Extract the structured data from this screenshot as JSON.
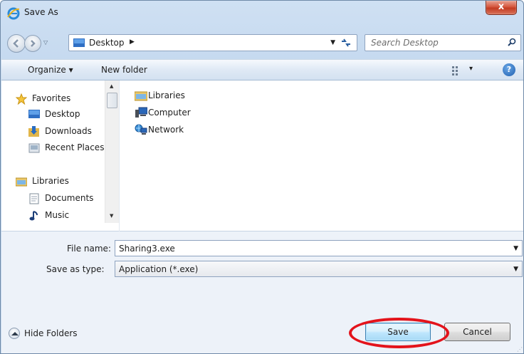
{
  "window": {
    "title": "Save As",
    "close_glyph": "x"
  },
  "address": {
    "location": "Desktop",
    "crumb_arrow": "▶",
    "search_placeholder": "Search Desktop"
  },
  "toolbar": {
    "organize_label": "Organize ▾",
    "new_folder_label": "New folder",
    "views_label": "▾",
    "help_label": "?"
  },
  "nav_pane": {
    "items": [
      {
        "label": "Favorites",
        "icon": "star-icon"
      },
      {
        "label": "Desktop",
        "icon": "desktop-icon"
      },
      {
        "label": "Downloads",
        "icon": "downloads-icon"
      },
      {
        "label": "Recent Places",
        "icon": "recent-places-icon"
      },
      {
        "label": "Libraries",
        "icon": "libraries-icon"
      },
      {
        "label": "Documents",
        "icon": "documents-icon"
      },
      {
        "label": "Music",
        "icon": "music-icon"
      }
    ]
  },
  "content": {
    "items": [
      {
        "label": "Libraries",
        "icon": "libraries-icon"
      },
      {
        "label": "Computer",
        "icon": "computer-icon"
      },
      {
        "label": "Network",
        "icon": "network-icon"
      }
    ]
  },
  "form": {
    "file_name_label": "File name:",
    "file_name_value": "Sharing3.exe",
    "save_type_label": "Save as type:",
    "save_type_value": "Application (*.exe)",
    "hide_folders_label": "Hide Folders",
    "save_label": "Save",
    "cancel_label": "Cancel"
  },
  "colors": {
    "highlight": "#e3131b",
    "chrome": "#b9d1ea"
  }
}
